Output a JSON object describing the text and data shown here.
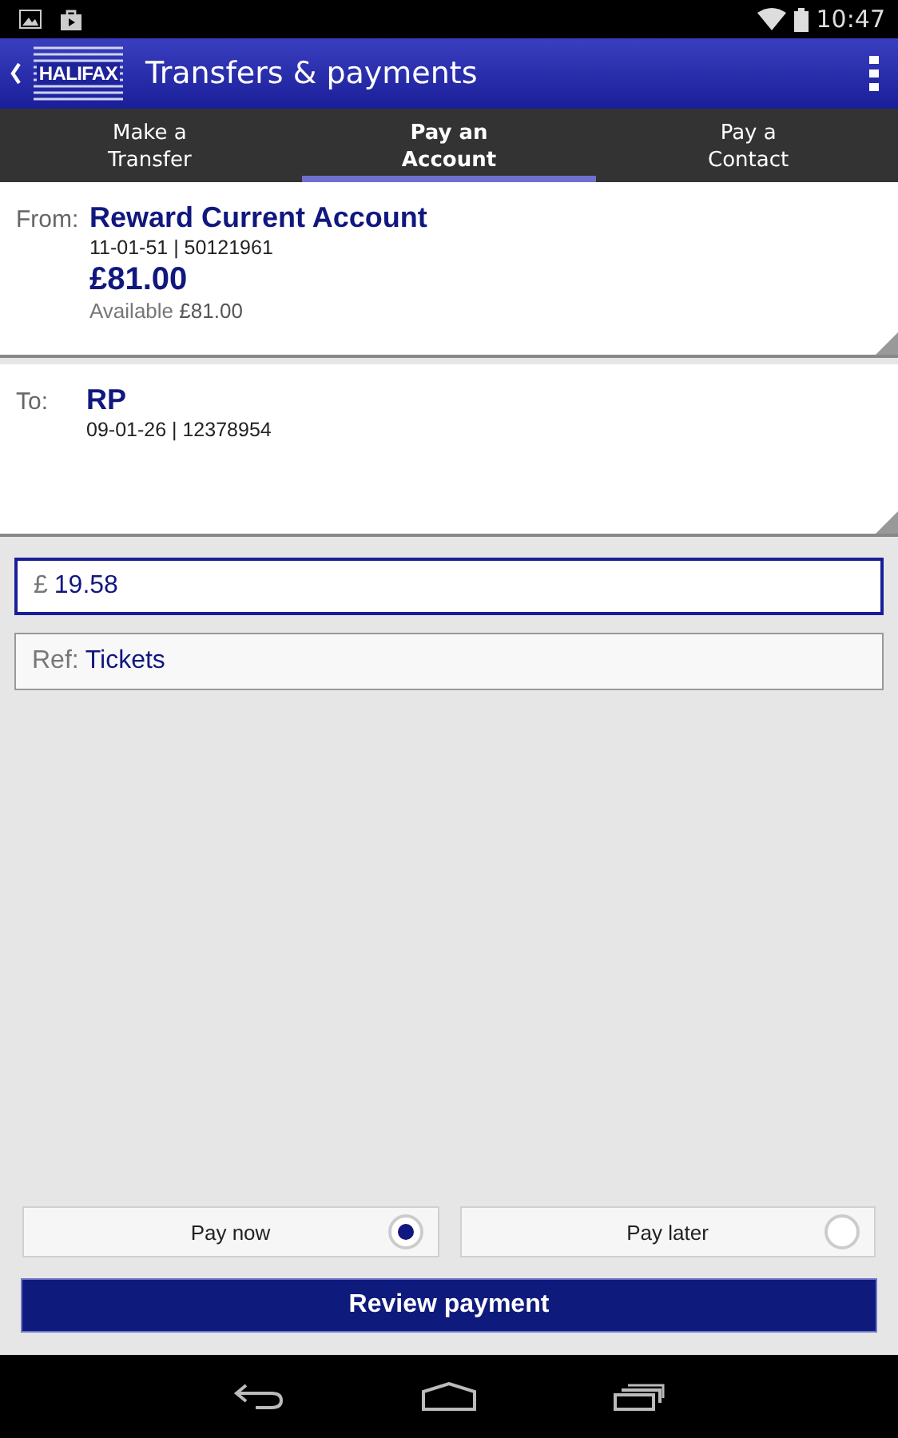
{
  "status_bar": {
    "time": "10:47"
  },
  "app_bar": {
    "logo": "HALIFAX",
    "title": "Transfers & payments"
  },
  "tabs": [
    {
      "label": "Make a\nTransfer",
      "selected": false
    },
    {
      "label": "Pay an\nAccount",
      "selected": true
    },
    {
      "label": "Pay a\nContact",
      "selected": false
    }
  ],
  "from": {
    "label": "From:",
    "name": "Reward Current Account",
    "details": "11-01-51 | 50121961",
    "balance": "£81.00",
    "available_label": "Available",
    "available_amount": "£81.00"
  },
  "to": {
    "label": "To:",
    "name": "RP",
    "details": "09-01-26 | 12378954"
  },
  "amount": {
    "currency": "£",
    "value": "19.58",
    "focused": true
  },
  "reference": {
    "label": "Ref:",
    "value": "Tickets"
  },
  "timing": [
    {
      "label": "Pay now",
      "selected": true
    },
    {
      "label": "Pay later",
      "selected": false
    }
  ],
  "primary_button": "Review payment"
}
